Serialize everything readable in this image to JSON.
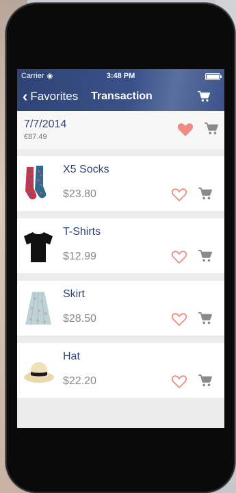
{
  "status_bar": {
    "carrier": "Carrier",
    "time": "3:48 PM"
  },
  "nav": {
    "back_label": "Favorites",
    "title": "Transaction"
  },
  "summary": {
    "date": "7/7/2014",
    "total": "€87.49"
  },
  "items": [
    {
      "name": "X5 Socks",
      "price": "$23.80"
    },
    {
      "name": "T-Shirts",
      "price": "$12.99"
    },
    {
      "name": "Skirt",
      "price": "$28.50"
    },
    {
      "name": "Hat",
      "price": "$22.20"
    }
  ],
  "colors": {
    "nav_bar": "#2f4374",
    "accent_heart": "#f08b84",
    "text_primary": "#2f4374",
    "text_price": "#8a8a8a",
    "icon_gray": "#8a8a8a"
  }
}
